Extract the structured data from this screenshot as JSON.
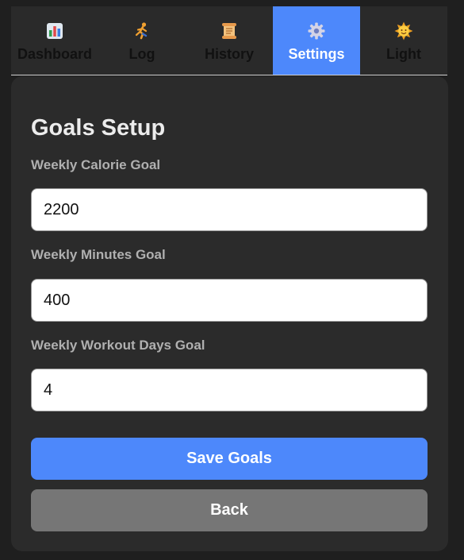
{
  "nav": {
    "tabs": [
      {
        "label": "Dashboard",
        "icon": "bar-chart-icon"
      },
      {
        "label": "Log",
        "icon": "runner-icon"
      },
      {
        "label": "History",
        "icon": "scroll-icon"
      },
      {
        "label": "Settings",
        "icon": "gear-icon",
        "active": true
      },
      {
        "label": "Light",
        "icon": "sun-icon"
      }
    ]
  },
  "panel": {
    "title": "Goals Setup",
    "fields": [
      {
        "label": "Weekly Calorie Goal",
        "value": "2200"
      },
      {
        "label": "Weekly Minutes Goal",
        "value": "400"
      },
      {
        "label": "Weekly Workout Days Goal",
        "value": "4"
      }
    ],
    "save_label": "Save Goals",
    "back_label": "Back"
  },
  "colors": {
    "accent": "#4d88fb",
    "background": "#1f1f1f",
    "panel": "#2b2b2b",
    "secondary_button": "#767676"
  }
}
